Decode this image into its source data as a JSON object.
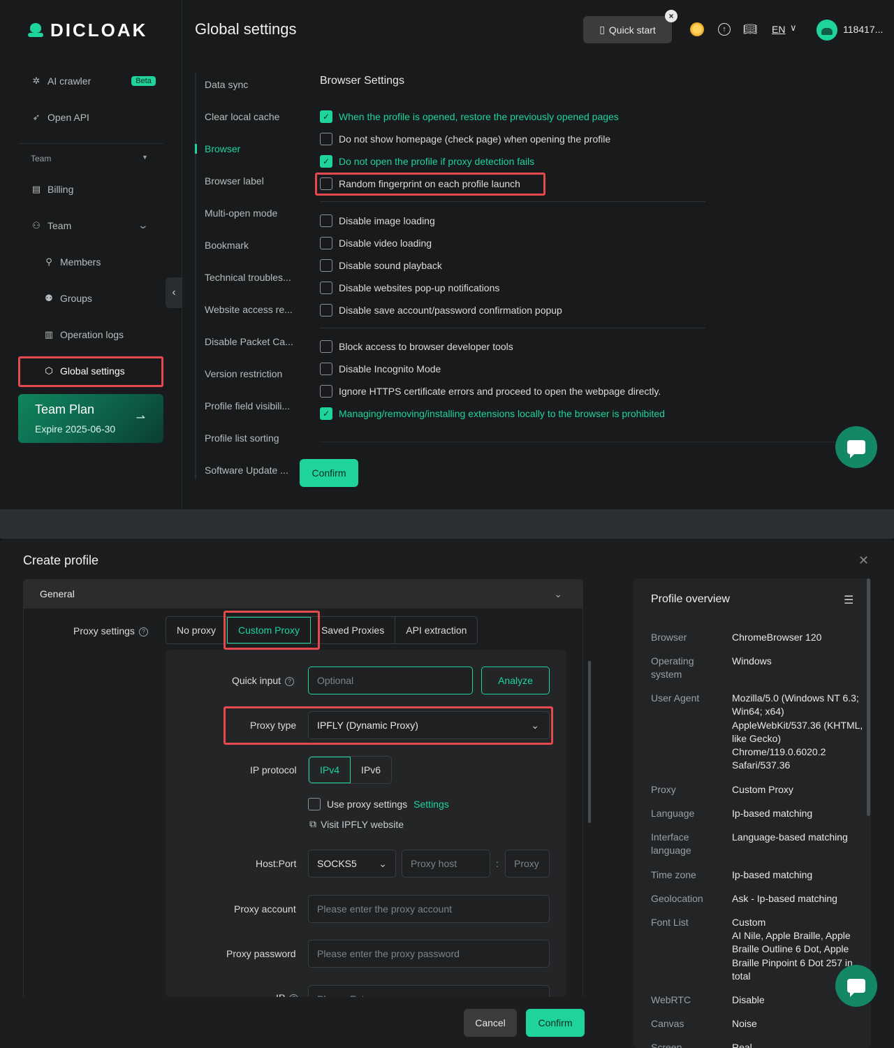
{
  "app": {
    "logo": "DICLOAK",
    "page_title": "Global settings"
  },
  "header": {
    "quick_start": "Quick start",
    "lang": "EN",
    "user_id": "118417..."
  },
  "sidebar": {
    "ai_crawler": "AI crawler",
    "beta": "Beta",
    "open_api": "Open API",
    "team_section": "Team",
    "billing": "Billing",
    "team": "Team",
    "members": "Members",
    "groups": "Groups",
    "operation_logs": "Operation logs",
    "global_settings": "Global settings",
    "plan_title": "Team Plan",
    "plan_expire": "Expire 2025-06-30"
  },
  "settings_nav": [
    "Data sync",
    "Clear local cache",
    "Browser",
    "Browser label",
    "Multi-open mode",
    "Bookmark",
    "Technical troubles...",
    "Website access re...",
    "Disable Packet Ca...",
    "Version restriction",
    "Profile field visibili...",
    "Profile list sorting",
    "Software Update ..."
  ],
  "browser_settings": {
    "title": "Browser Settings",
    "group1": [
      {
        "label": "When the profile is opened, restore the previously opened pages",
        "checked": true
      },
      {
        "label": "Do not show homepage (check page) when opening the profile",
        "checked": false
      },
      {
        "label": "Do not open the profile if proxy detection fails",
        "checked": true
      },
      {
        "label": "Random fingerprint on each profile launch",
        "checked": false
      }
    ],
    "group2": [
      {
        "label": "Disable image loading",
        "checked": false
      },
      {
        "label": "Disable video loading",
        "checked": false
      },
      {
        "label": "Disable sound playback",
        "checked": false
      },
      {
        "label": "Disable websites pop-up notifications",
        "checked": false
      },
      {
        "label": "Disable save account/password confirmation popup",
        "checked": false
      }
    ],
    "group3": [
      {
        "label": "Block access to browser developer tools",
        "checked": false
      },
      {
        "label": "Disable Incognito Mode",
        "checked": false
      },
      {
        "label": "Ignore HTTPS certificate errors and proceed to open the webpage directly.",
        "checked": false
      },
      {
        "label": "Managing/removing/installing extensions locally to the browser is prohibited",
        "checked": true
      }
    ],
    "confirm": "Confirm"
  },
  "create_profile": {
    "title": "Create profile",
    "general": "General",
    "proxy_settings_label": "Proxy settings",
    "proxy_tabs": [
      "No proxy",
      "Custom Proxy",
      "Saved Proxies",
      "API extraction"
    ],
    "quick_input_label": "Quick input",
    "quick_input_placeholder": "Optional",
    "analyze": "Analyze",
    "proxy_type_label": "Proxy type",
    "proxy_type_value": "IPFLY (Dynamic Proxy)",
    "ip_protocol_label": "IP protocol",
    "ip_protocols": [
      "IPv4",
      "IPv6"
    ],
    "use_proxy_settings": "Use proxy settings",
    "settings_link": "Settings",
    "visit_site": "Visit IPFLY website",
    "host_port_label": "Host:Port",
    "protocol_value": "SOCKS5",
    "proxy_host_placeholder": "Proxy host",
    "port_placeholder": "Proxy",
    "colon": ":",
    "proxy_account_label": "Proxy account",
    "proxy_account_placeholder": "Please enter the proxy account",
    "proxy_password_label": "Proxy password",
    "proxy_password_placeholder": "Please enter the proxy password",
    "ip_label": "IP",
    "ip_placeholder": "Please Enter",
    "cancel": "Cancel",
    "confirm": "Confirm"
  },
  "overview": {
    "title": "Profile overview",
    "rows": [
      {
        "k": "Browser",
        "v": "ChromeBrowser 120"
      },
      {
        "k": "Operating system",
        "v": "Windows"
      },
      {
        "k": "User Agent",
        "v": "Mozilla/5.0 (Windows NT 6.3; Win64; x64) AppleWebKit/537.36 (KHTML, like Gecko) Chrome/119.0.6020.2 Safari/537.36"
      },
      {
        "k": "Proxy",
        "v": "Custom Proxy"
      },
      {
        "k": "Language",
        "v": "Ip-based matching"
      },
      {
        "k": "Interface language",
        "v": "Language-based matching"
      },
      {
        "k": "Time zone",
        "v": "Ip-based matching"
      },
      {
        "k": "Geolocation",
        "v": "Ask - Ip-based matching"
      },
      {
        "k": "Font List",
        "v": "Custom"
      },
      {
        "k": "",
        "v": "AI Nile, Apple Braille, Apple Braille Outline 6 Dot, Apple Braille Pinpoint 6 Dot 257 in total"
      },
      {
        "k": "WebRTC",
        "v": "Disable"
      },
      {
        "k": "Canvas",
        "v": "Noise"
      },
      {
        "k": "Screen",
        "v": "Real"
      }
    ]
  }
}
